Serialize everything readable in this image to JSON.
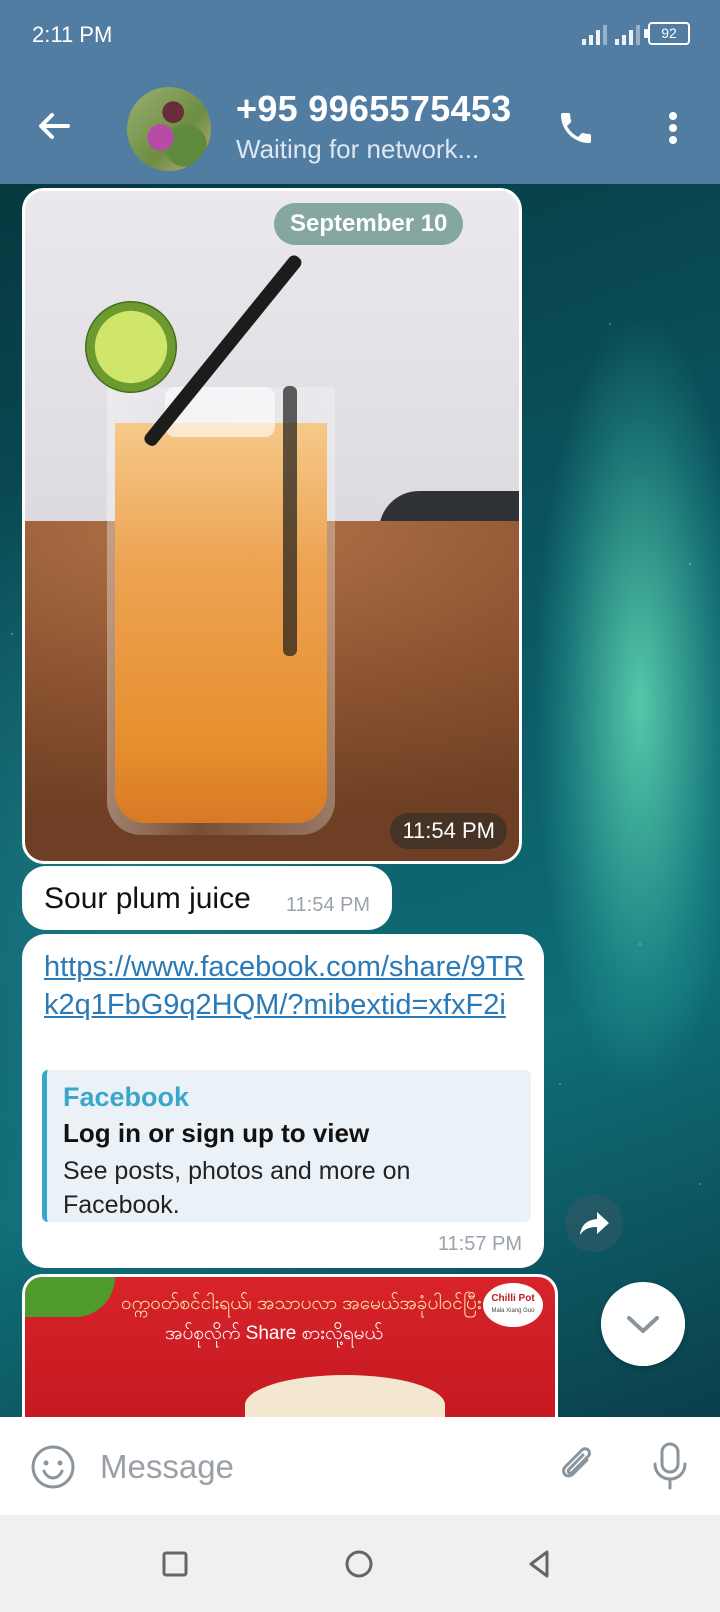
{
  "status_bar": {
    "time": "2:11 PM",
    "battery": "92"
  },
  "app_bar": {
    "contact_name": "+95 9965575453",
    "status": "Waiting for network..."
  },
  "chat": {
    "date_separator": "September 10",
    "photo_message": {
      "time": "11:54 PM"
    },
    "text_message": {
      "text": "Sour plum juice",
      "time": "11:54 PM"
    },
    "link_message": {
      "url": "https://www.facebook.com/share/9TRk2q1FbG9q2HQM/?mibextid=xfxF2i",
      "preview_site": "Facebook",
      "preview_title": "Log in or sign up to view",
      "preview_description": "See posts, photos and more on Facebook.",
      "time": "11:57 PM"
    },
    "poster_message": {
      "line1": "ဝက္ကဝတ်စင်ငါးရယ်၊ အသာပလာ အမေယ်အခုံပါဝင်ပြီး",
      "line2": "အပ်စုလိုက် Share စားလို့ရမယ်",
      "logo": "Chilli Pot",
      "logo_sub": "Mala Xiang Guo"
    }
  },
  "input": {
    "placeholder": "Message"
  },
  "colors": {
    "header": "#527da3",
    "link": "#2a7ab8",
    "preview_accent": "#3ba6c9"
  }
}
